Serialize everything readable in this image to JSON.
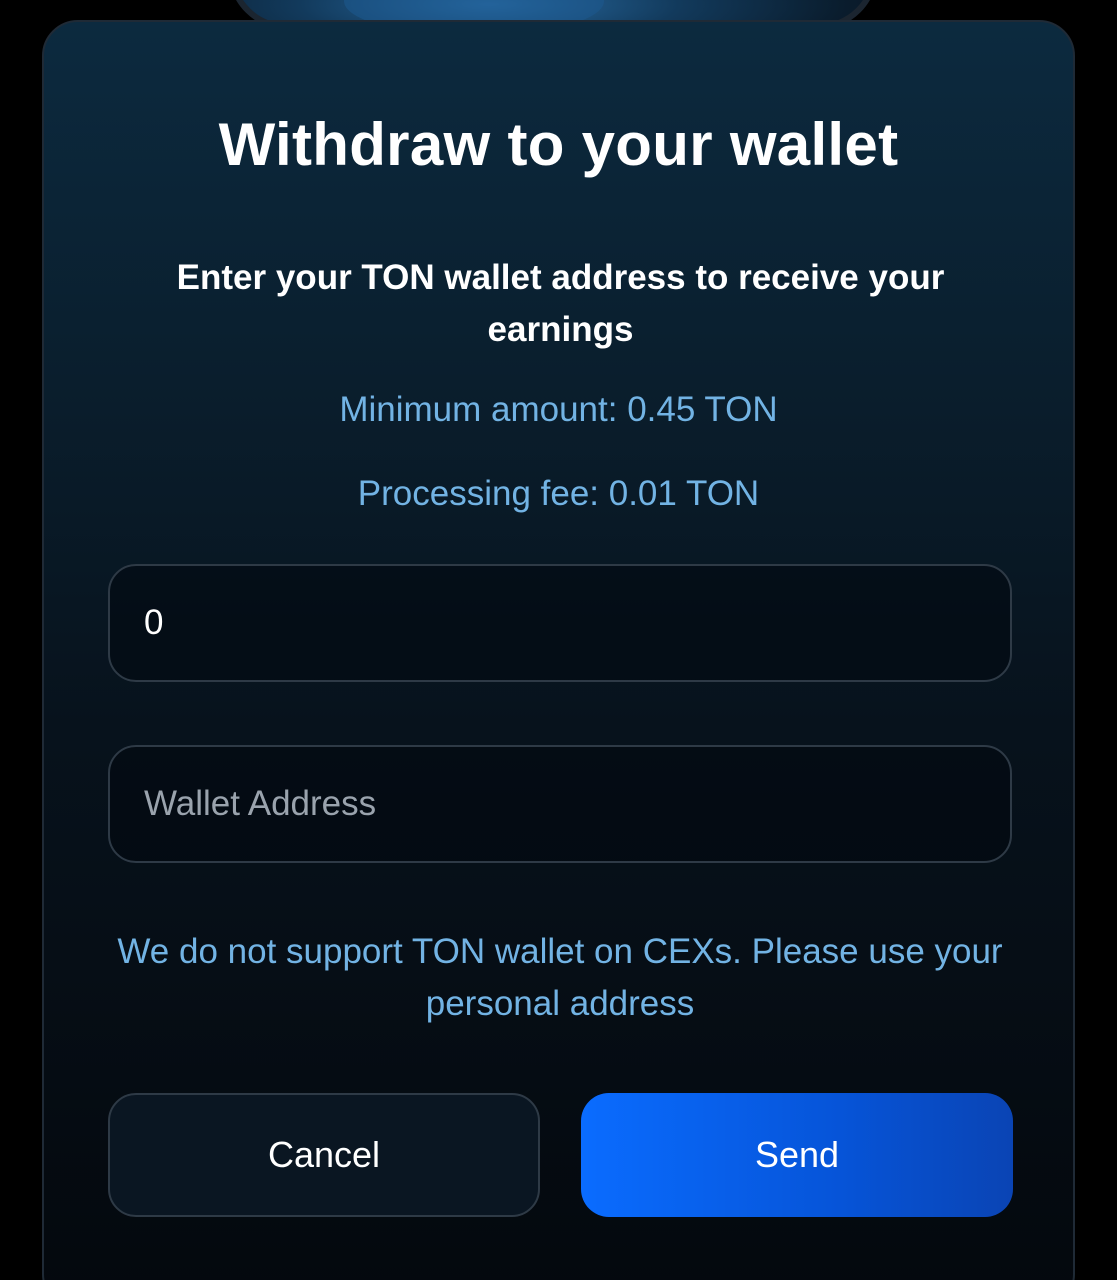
{
  "modal": {
    "title": "Withdraw to your wallet",
    "subtitle": "Enter your TON wallet address to receive your earnings",
    "minimum_amount": "Minimum amount: 0.45 TON",
    "processing_fee": "Processing fee: 0.01 TON",
    "amount_input": {
      "value": "0",
      "placeholder": ""
    },
    "wallet_input": {
      "value": "",
      "placeholder": "Wallet Address"
    },
    "notice": "We do not support TON wallet on CEXs. Please use your personal address",
    "cancel_label": "Cancel",
    "send_label": "Send"
  },
  "colors": {
    "accent": "#0a6cff",
    "info_text": "#72b3e4",
    "background": "#000000"
  }
}
